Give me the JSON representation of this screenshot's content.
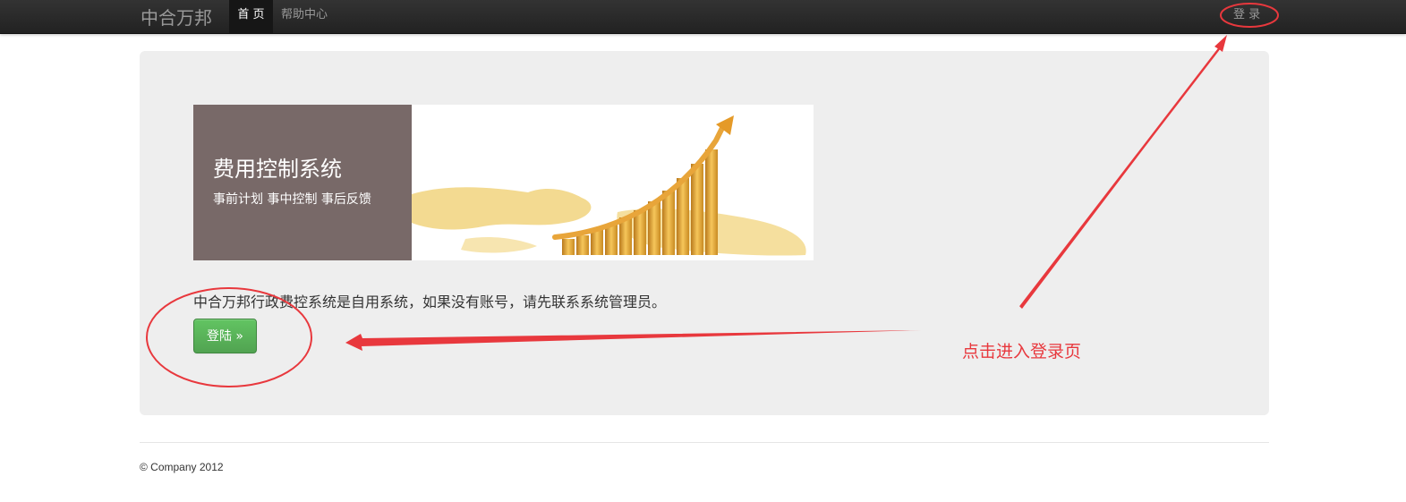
{
  "navbar": {
    "brand": "中合万邦",
    "home": "首 页",
    "help": "帮助中心",
    "login": "登 录"
  },
  "banner": {
    "title": "费用控制系统",
    "subtitle": "事前计划 事中控制 事后反馈"
  },
  "hero": {
    "description": "中合万邦行政费控系统是自用系统，如果没有账号，请先联系系统管理员。",
    "button_label": "登陆 »"
  },
  "footer": {
    "copyright": "© Company 2012"
  },
  "annotation": {
    "label": "点击进入登录页",
    "color": "#e8383d"
  },
  "colors": {
    "navbar": "#222222",
    "banner_panel": "#786968",
    "button_green": "#5bb75b",
    "hero_bg": "#eeeeee"
  }
}
